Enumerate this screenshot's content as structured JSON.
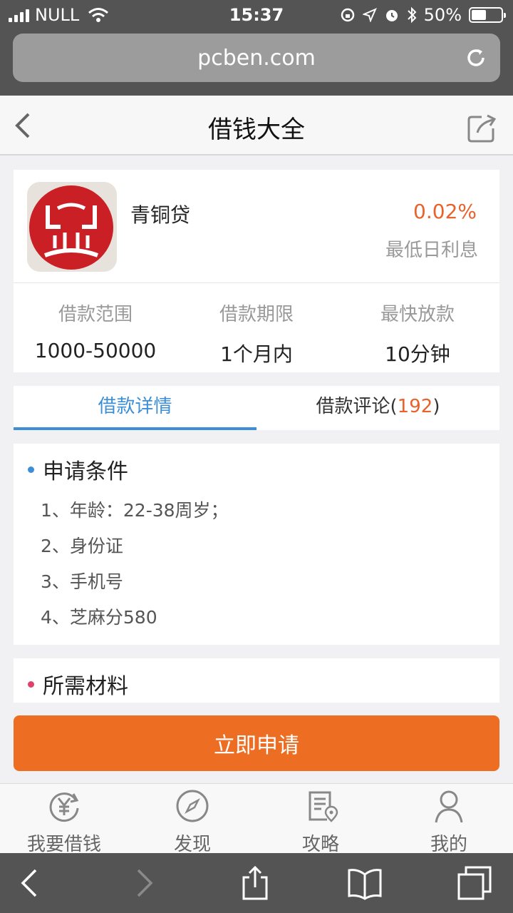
{
  "status_bar": {
    "carrier": "NULL",
    "time": "15:37",
    "battery": "50%",
    "battery_level": 0.5
  },
  "browser": {
    "url": "pcben.com"
  },
  "nav": {
    "title": "借钱大全"
  },
  "product": {
    "name": "青铜贷",
    "rate": "0.02%",
    "rate_label": "最低日利息",
    "stats": [
      {
        "label": "借款范围",
        "value": "1000-50000"
      },
      {
        "label": "借款期限",
        "value": "1个月内"
      },
      {
        "label": "最快放款",
        "value": "10分钟"
      }
    ]
  },
  "tabs": {
    "detail": "借款详情",
    "comments_label": "借款评论(",
    "comments_count": "192",
    "comments_close": ")"
  },
  "conditions": {
    "title": "申请条件",
    "items": [
      "1、年龄：22-38周岁；",
      "2、身份证",
      "3、手机号",
      "4、芝麻分580"
    ]
  },
  "materials": {
    "title": "所需材料"
  },
  "apply_button": "立即申请",
  "tab_bar": [
    {
      "label": "我要借钱",
      "icon": "yen-refresh-icon"
    },
    {
      "label": "发现",
      "icon": "compass-icon"
    },
    {
      "label": "攻略",
      "icon": "document-location-icon"
    },
    {
      "label": "我的",
      "icon": "person-icon"
    }
  ],
  "colors": {
    "accent_blue": "#3c8fd6",
    "accent_orange": "#ed6d23",
    "rate_orange": "#e8622c",
    "logo_red": "#c91f25"
  }
}
